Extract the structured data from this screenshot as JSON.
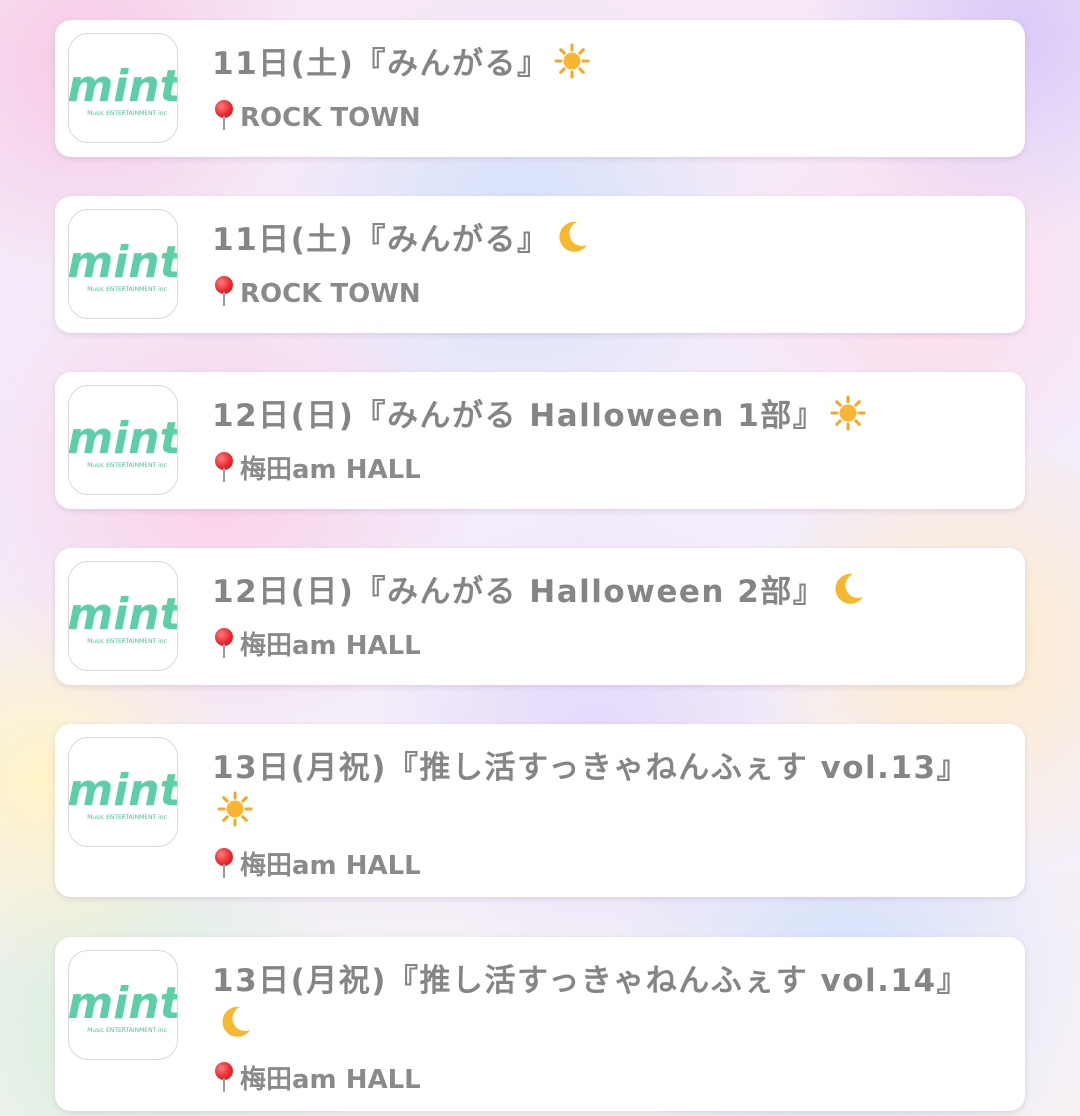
{
  "events": [
    {
      "title": "11日(土)『みんがる』",
      "weather_icon": "sun-icon",
      "venue": "ROCK TOWN"
    },
    {
      "title": "11日(土)『みんがる』",
      "weather_icon": "crescent-moon-icon",
      "venue": "ROCK TOWN"
    },
    {
      "title": "12日(日)『みんがる Halloween 1部』",
      "weather_icon": "sun-icon",
      "venue": "梅田am HALL"
    },
    {
      "title": "12日(日)『みんがる Halloween 2部』",
      "weather_icon": "crescent-moon-icon",
      "venue": "梅田am HALL"
    },
    {
      "title": "13日(月祝)『推し活すっきゃねんふぇす vol.13』",
      "weather_icon": "sun-icon",
      "venue": "梅田am HALL"
    },
    {
      "title": "13日(月祝)『推し活すっきゃねんふぇす vol.14』",
      "weather_icon": "crescent-moon-icon",
      "venue": "梅田am HALL"
    }
  ],
  "logo": {
    "text": "mint",
    "subtext": "Music ENTERTAINMENT inc",
    "icon": "mint-logo-icon",
    "color": "#5cd0a4"
  },
  "venue_icon": "round-pushpin-icon",
  "colors": {
    "card_background": "#ffffff",
    "title_text": "#858585",
    "venue_text": "#8a8a8a",
    "sun": "#f6a623",
    "moon": "#f5b82e",
    "pin": "#e8282e"
  }
}
